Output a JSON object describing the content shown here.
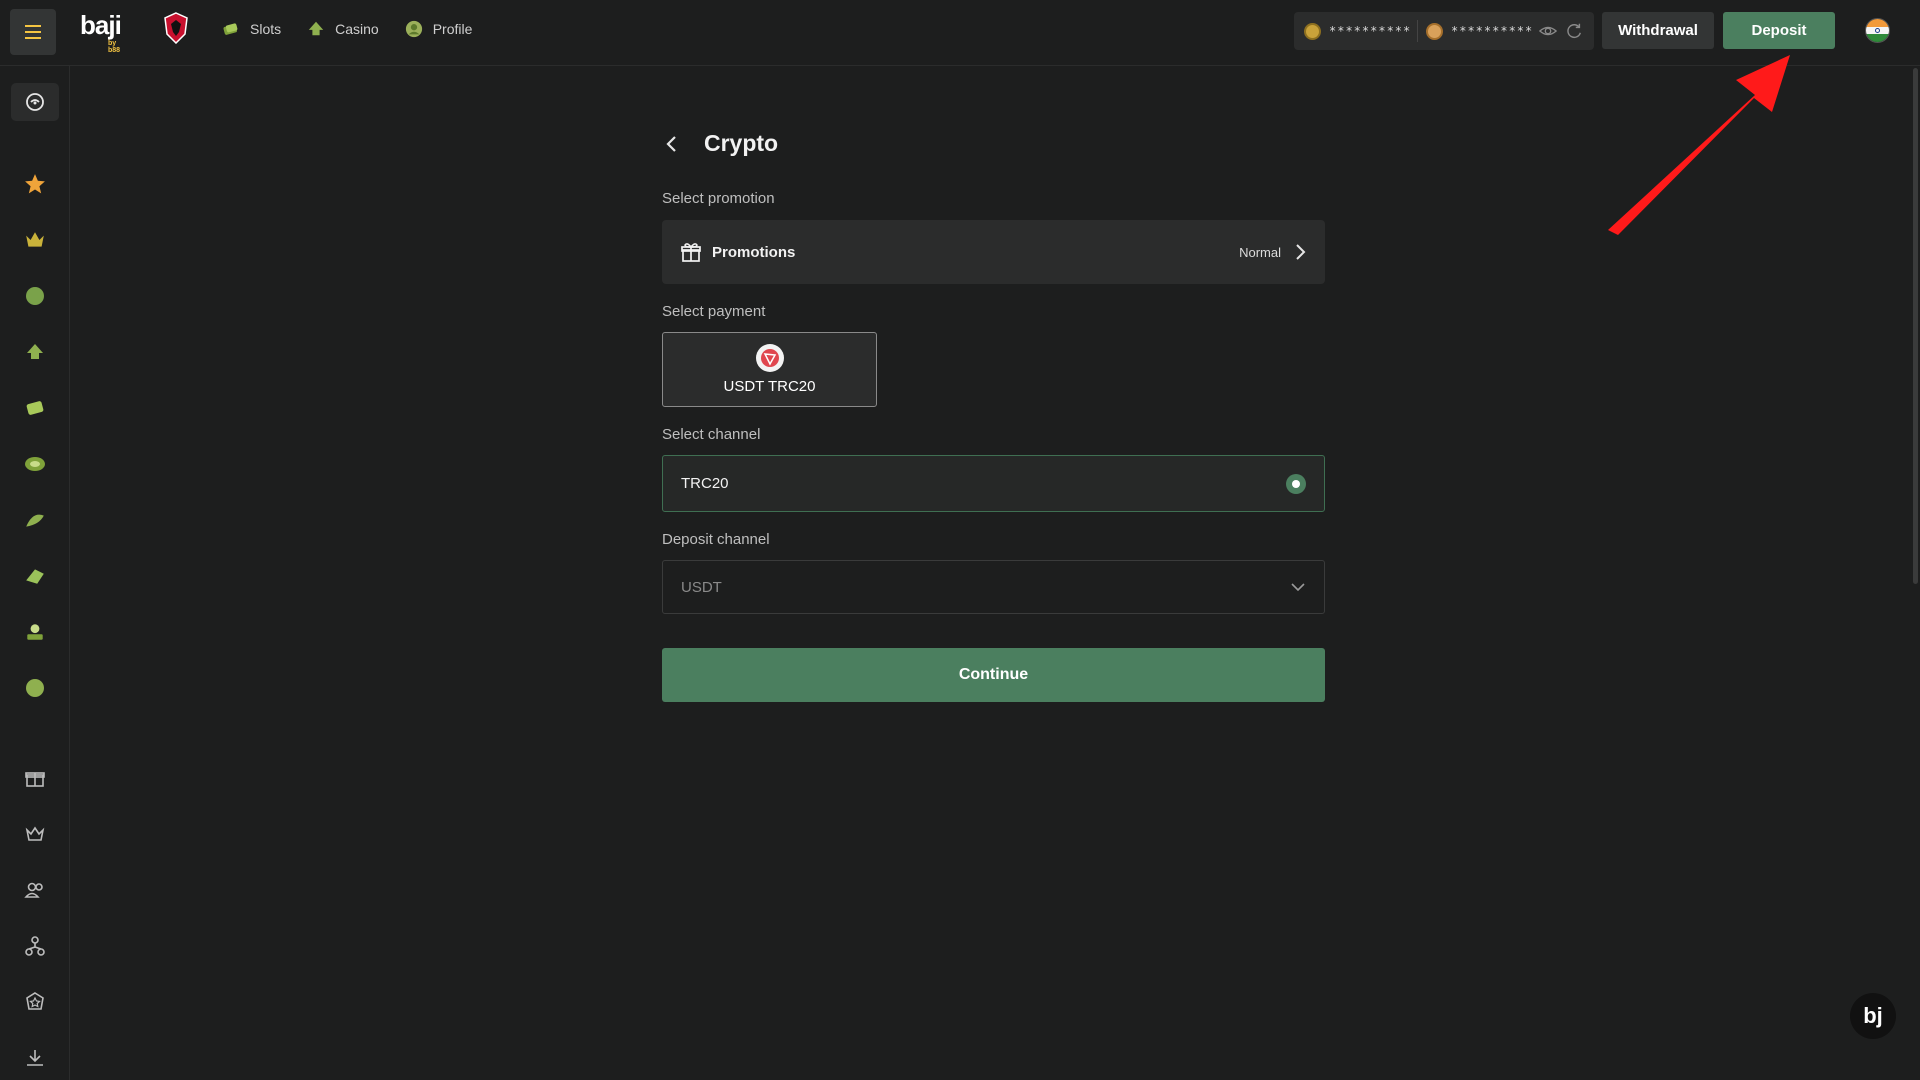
{
  "header": {
    "logo": "baji",
    "logo_sub": "by b88",
    "nav": [
      {
        "label": "Slots",
        "icon": "slots-icon"
      },
      {
        "label": "Casino",
        "icon": "casino-icon"
      },
      {
        "label": "Profile",
        "icon": "profile-icon"
      }
    ],
    "balance_main": "**********",
    "balance_bonus": "**********",
    "withdrawal_label": "Withdrawal",
    "deposit_label": "Deposit"
  },
  "page": {
    "title": "Crypto",
    "promotion_label": "Select promotion",
    "promotion_title": "Promotions",
    "promotion_value": "Normal",
    "payment_label": "Select payment",
    "payment_option": "USDT TRC20",
    "channel_label": "Select channel",
    "channel_option": "TRC20",
    "deposit_channel_label": "Deposit channel",
    "deposit_channel_value": "USDT",
    "continue_label": "Continue"
  },
  "float_logo": "bj",
  "colors": {
    "accent_green": "#4b7f5f",
    "background": "#1d1e1e",
    "panel": "#2b2c2c",
    "annotation_arrow": "#ff1a1a"
  }
}
